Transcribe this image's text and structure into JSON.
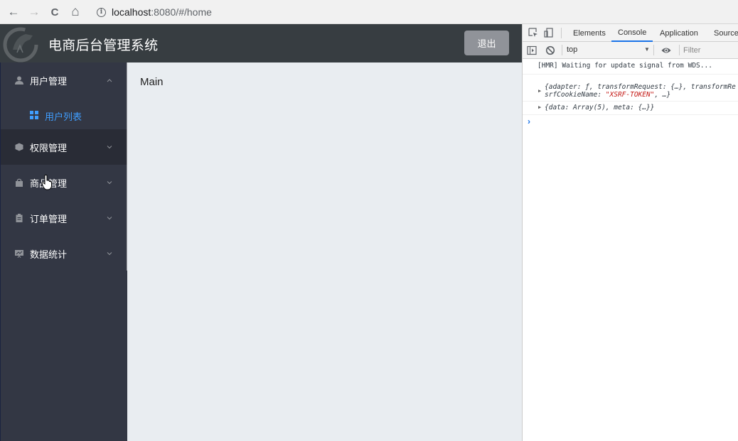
{
  "browser": {
    "back_icon": "←",
    "forward_icon": "→",
    "reload_icon": "C",
    "home_icon": "⌂",
    "info_icon": "i",
    "url_host": "localhost",
    "url_rest": ":8080/#/home"
  },
  "header": {
    "title": "电商后台管理系统",
    "logout_label": "退出"
  },
  "sidebar": {
    "items": [
      {
        "label": "用户管理",
        "icon": "user-icon",
        "expanded": true,
        "children": [
          {
            "label": "用户列表",
            "icon": "grid-icon",
            "active": true
          }
        ]
      },
      {
        "label": "权限管理",
        "icon": "cube-icon",
        "expanded": false,
        "hovered": true
      },
      {
        "label": "商品管理",
        "icon": "bag-icon",
        "expanded": false
      },
      {
        "label": "订单管理",
        "icon": "clipboard-icon",
        "expanded": false
      },
      {
        "label": "数据统计",
        "icon": "chart-icon",
        "expanded": false
      }
    ]
  },
  "main": {
    "text": "Main"
  },
  "devtools": {
    "tabs": [
      {
        "label": "Elements",
        "active": false
      },
      {
        "label": "Console",
        "active": true
      },
      {
        "label": "Application",
        "active": false
      },
      {
        "label": "Sources",
        "active": false
      }
    ],
    "context": "top",
    "filter_placeholder": "Filter",
    "console": {
      "line1": "[HMR] Waiting for update signal from WDS...",
      "line2a": "{adapter: ƒ, transformRequest: {…}, transformRe",
      "line2b_pre": "srfCookieName: ",
      "line2b_str": "\"XSRF-TOKEN\"",
      "line2b_post": ", …}",
      "line3": "{data: Array(5), meta: {…}}",
      "prompt": "›"
    }
  },
  "colors": {
    "header_bg": "#373d41",
    "sidebar_bg": "#333744",
    "main_bg": "#e9edf1",
    "active_link": "#409eff",
    "logout_bg": "#909399"
  }
}
